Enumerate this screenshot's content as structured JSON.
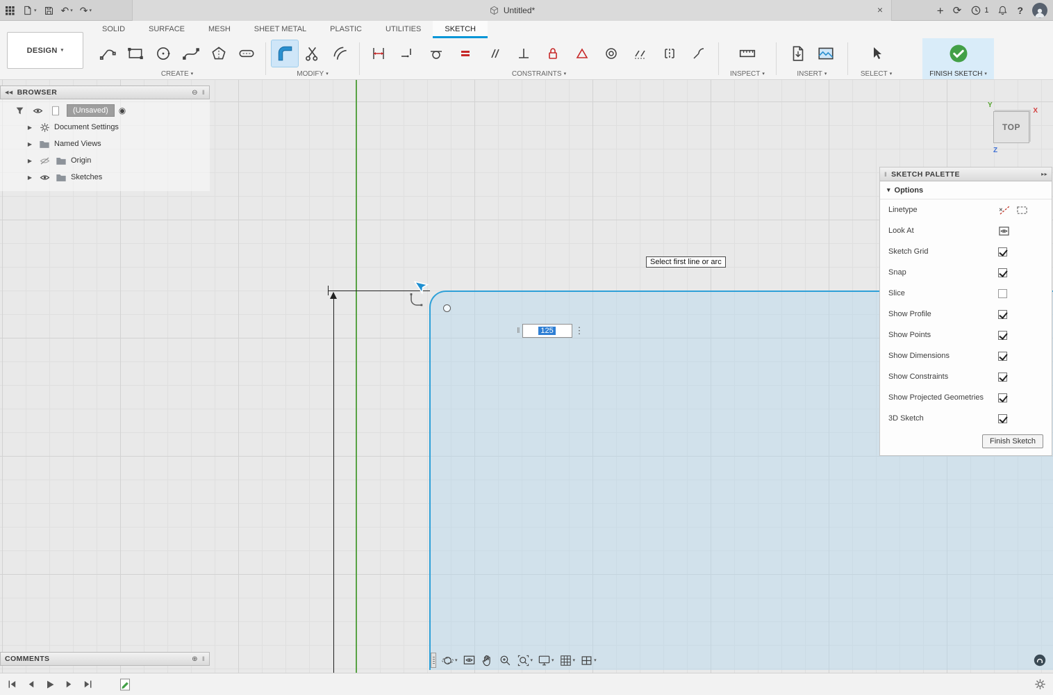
{
  "colors": {
    "accent_blue": "#0696d7",
    "sketch_line_blue": "#2da0d8",
    "axis_green": "#58a244",
    "constraint_red": "#c62828",
    "finish_green": "#43a047",
    "selection_fill": "#b0d6ee"
  },
  "icons": {
    "caret_down": "▾",
    "expander": "▶",
    "collapse_left": "◀◀",
    "collapse_right": "▸▸",
    "grip": "‖",
    "dots_vertical": "⋮",
    "close": "×",
    "plus": "+",
    "help": "?",
    "undo": "↶",
    "redo": "↷",
    "sync": "⟳",
    "minus_circle": "⊖",
    "plus_circle": "⊕",
    "record": "◉"
  },
  "titlebar": {
    "title": "Untitled*",
    "job_count": "1"
  },
  "toolbar": {
    "design_label": "DESIGN",
    "tabs": [
      "SOLID",
      "SURFACE",
      "MESH",
      "SHEET METAL",
      "PLASTIC",
      "UTILITIES",
      "SKETCH"
    ],
    "active_tab": "SKETCH",
    "groups": {
      "create": "CREATE",
      "modify": "MODIFY",
      "constraints": "CONSTRAINTS",
      "inspect": "INSPECT",
      "insert": "INSERT",
      "select": "SELECT",
      "finish": "FINISH SKETCH"
    }
  },
  "browser": {
    "title": "BROWSER",
    "root_label": "(Unsaved)",
    "items": [
      "Document Settings",
      "Named Views",
      "Origin",
      "Sketches"
    ]
  },
  "viewcube": {
    "face": "TOP",
    "axis_x": "X",
    "axis_y": "Y",
    "axis_z": "Z"
  },
  "palette": {
    "title": "SKETCH PALETTE",
    "section": "Options",
    "rows": [
      {
        "label": "Linetype"
      },
      {
        "label": "Look At"
      },
      {
        "label": "Sketch Grid",
        "checked": true
      },
      {
        "label": "Snap",
        "checked": true
      },
      {
        "label": "Slice",
        "checked": false
      },
      {
        "label": "Show Profile",
        "checked": true
      },
      {
        "label": "Show Points",
        "checked": true
      },
      {
        "label": "Show Dimensions",
        "checked": true
      },
      {
        "label": "Show Constraints",
        "checked": true
      },
      {
        "label": "Show Projected Geometries",
        "checked": true
      },
      {
        "label": "3D Sketch",
        "checked": true
      }
    ],
    "finish_button": "Finish Sketch"
  },
  "canvas": {
    "tooltip": "Select first line or arc",
    "dimension_value": "125"
  },
  "comments": {
    "title": "COMMENTS"
  }
}
